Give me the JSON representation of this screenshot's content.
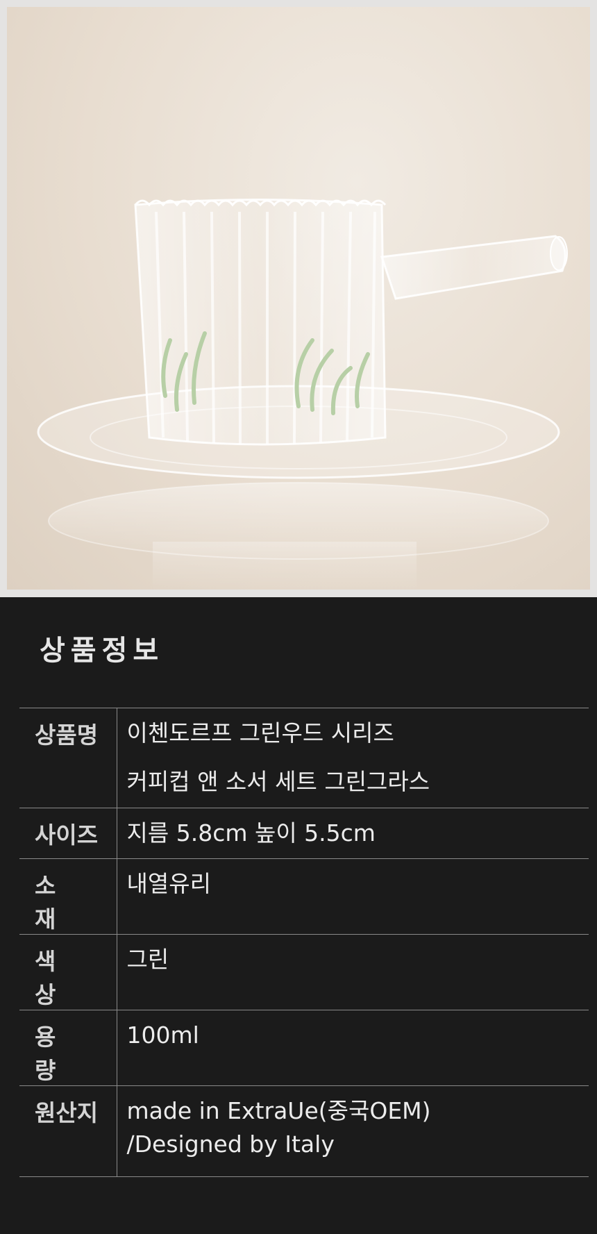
{
  "photo": {
    "subject": "glass-cup-and-saucer",
    "colors": {
      "background": "#e8ddd0",
      "frame": "#e4e3e2",
      "grass": "#b7cfa6"
    }
  },
  "info": {
    "title": "상품정보",
    "rows": [
      {
        "label": "상품명",
        "lines": [
          "이첸도르프 그린우드 시리즈",
          "커피컵 앤 소서 세트 그린그라스"
        ]
      },
      {
        "label": "사이즈",
        "lines": [
          "지름 5.8cm 높이 5.5cm"
        ]
      },
      {
        "label": "소재",
        "lines": [
          "내열유리"
        ]
      },
      {
        "label": "색상",
        "lines": [
          "그린"
        ]
      },
      {
        "label": "용량",
        "lines": [
          "100ml"
        ]
      },
      {
        "label": "원산지",
        "lines": [
          "made in ExtraUe(중국OEM)",
          "/Designed by Italy"
        ]
      }
    ],
    "colors": {
      "background": "#1b1b1b",
      "text": "#ececec",
      "line": "#8a8a8a"
    }
  }
}
